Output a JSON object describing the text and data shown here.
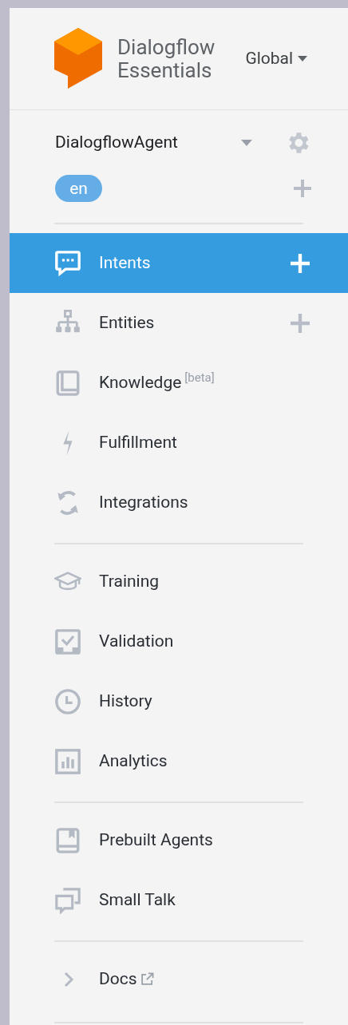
{
  "header": {
    "product_name_line_1": "Dialogflow",
    "product_name_line_2": "Essentials",
    "region": "Global"
  },
  "agent": {
    "name": "DialogflowAgent",
    "languages": [
      {
        "label": "en",
        "selected": true
      }
    ]
  },
  "nav_sections": [
    [
      {
        "kind": "page",
        "label": "Intents",
        "selected": true,
        "add": true
      },
      {
        "kind": "page",
        "label": "Entities",
        "selected": false,
        "add": true
      },
      {
        "kind": "page",
        "label": "Knowledge",
        "badge": "[beta]",
        "selected": false
      },
      {
        "kind": "page",
        "label": "Fulfillment",
        "selected": false
      },
      {
        "kind": "page",
        "label": "Integrations",
        "selected": false
      }
    ],
    [
      {
        "kind": "page",
        "label": "Training",
        "selected": false
      },
      {
        "kind": "page",
        "label": "Validation",
        "selected": false
      },
      {
        "kind": "page",
        "label": "History",
        "selected": false
      },
      {
        "kind": "page",
        "label": "Analytics",
        "selected": false
      }
    ],
    [
      {
        "kind": "page",
        "label": "Prebuilt Agents",
        "selected": false
      },
      {
        "kind": "page",
        "label": "Small Talk",
        "selected": false
      }
    ],
    [
      {
        "kind": "link",
        "label": "Docs",
        "selected": false
      }
    ]
  ]
}
